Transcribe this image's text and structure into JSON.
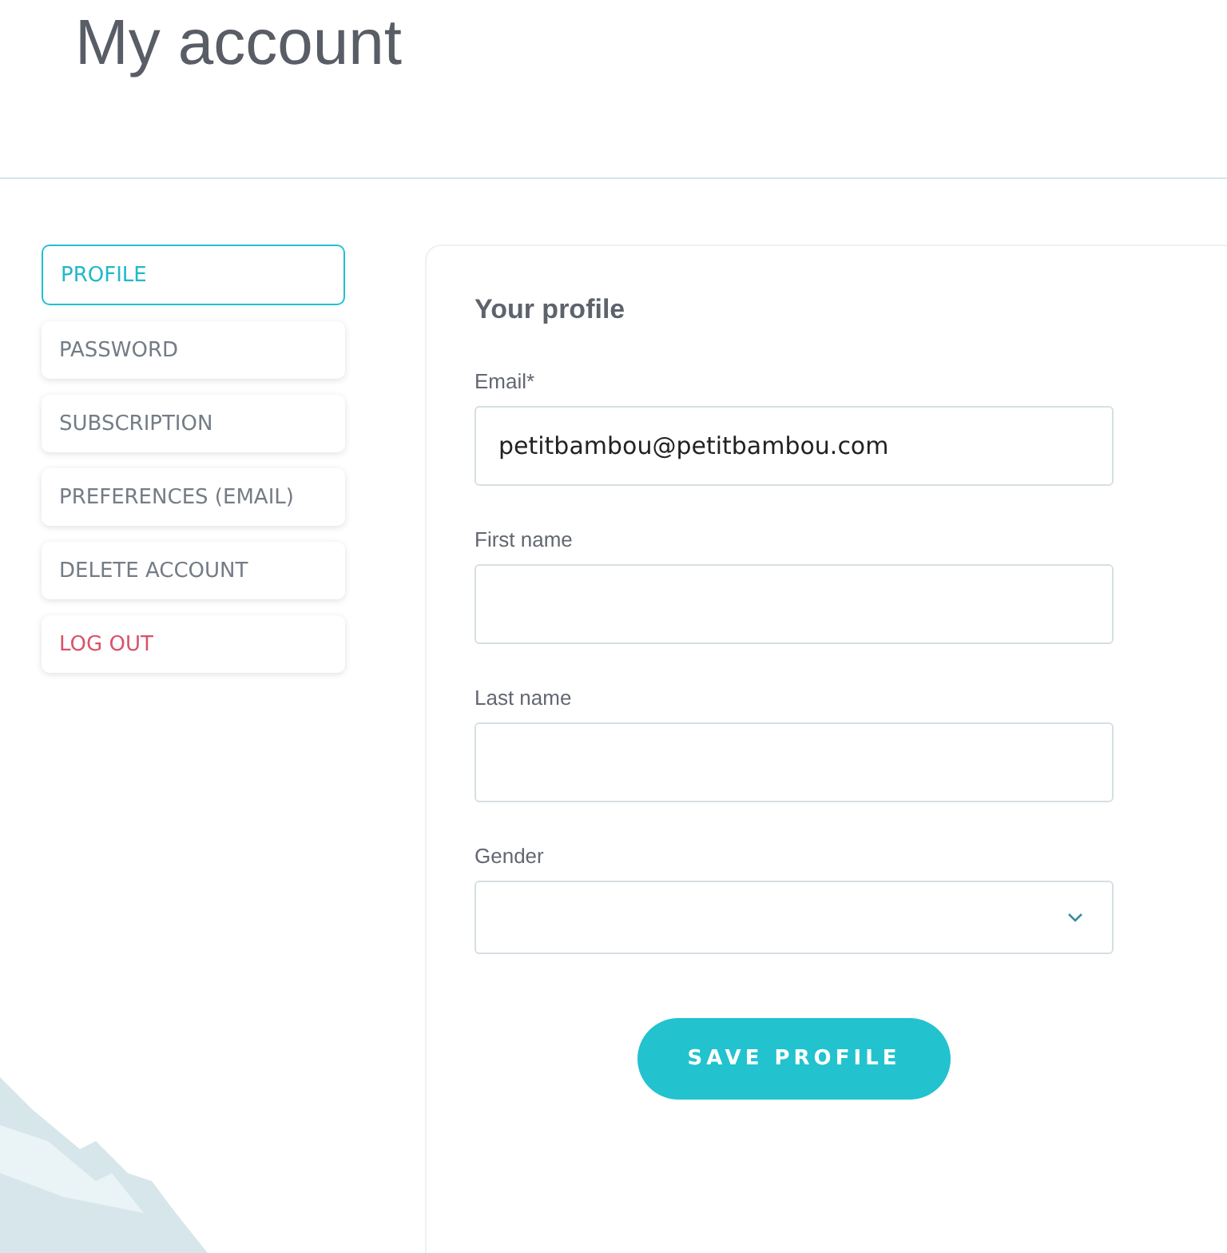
{
  "page": {
    "title": "My account"
  },
  "menu": [
    {
      "label": "PROFILE",
      "selected": true,
      "kind": "normal"
    },
    {
      "label": "PASSWORD",
      "selected": false,
      "kind": "normal"
    },
    {
      "label": "SUBSCRIPTION",
      "selected": false,
      "kind": "normal"
    },
    {
      "label": "PREFERENCES (EMAIL)",
      "selected": false,
      "kind": "normal"
    },
    {
      "label": "DELETE ACCOUNT",
      "selected": false,
      "kind": "normal"
    },
    {
      "label": "LOG OUT",
      "selected": false,
      "kind": "danger"
    }
  ],
  "form": {
    "title": "Your profile",
    "fields": [
      {
        "label": "Email*",
        "kind": "text",
        "value": "petitbambou@petitbambou.com"
      },
      {
        "label": "First name",
        "kind": "text"
      },
      {
        "label": "Last name",
        "kind": "text"
      },
      {
        "label": "Gender",
        "kind": "select"
      }
    ],
    "button": "SAVE PROFILE"
  }
}
